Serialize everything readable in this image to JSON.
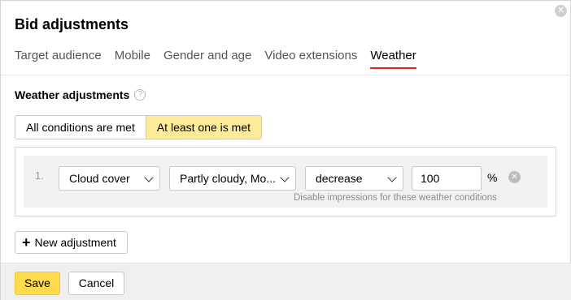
{
  "dialog": {
    "title": "Bid adjustments",
    "close_icon": "close-circle-icon"
  },
  "tabs": [
    {
      "label": "Target audience",
      "active": false
    },
    {
      "label": "Mobile",
      "active": false
    },
    {
      "label": "Gender and age",
      "active": false
    },
    {
      "label": "Video extensions",
      "active": false
    },
    {
      "label": "Weather",
      "active": true
    }
  ],
  "section": {
    "title": "Weather adjustments",
    "help_icon": "question-circle-icon",
    "help_glyph": "?"
  },
  "condition_mode": {
    "options": [
      "All conditions are met",
      "At least one is met"
    ],
    "selected": "At least one is met"
  },
  "rules": [
    {
      "number": "1.",
      "parameter": "Cloud cover",
      "value": "Partly cloudy, Mo...",
      "direction": "decrease",
      "amount": "100",
      "unit": "%",
      "hint": "Disable impressions for these weather conditions"
    }
  ],
  "actions": {
    "new_adjustment_label": "New adjustment",
    "plus_glyph": "+"
  },
  "footer": {
    "save_label": "Save",
    "cancel_label": "Cancel"
  },
  "colors": {
    "active_tab_underline": "#e0261f",
    "selected_segment_bg": "#fdeb9a",
    "save_button_bg": "#ffdb4d"
  }
}
